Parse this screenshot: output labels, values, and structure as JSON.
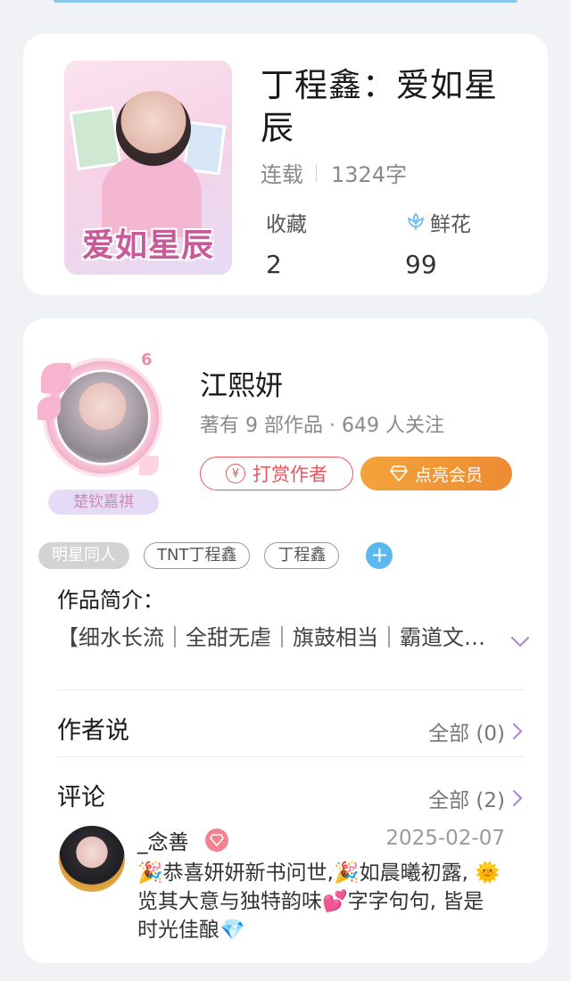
{
  "book": {
    "title": "丁程鑫：爱如星辰",
    "status": "连载",
    "word_count": "1324字",
    "cover_title": "爱如星辰",
    "favorites_label": "收藏",
    "favorites_value": "2",
    "flowers_label": "鲜花",
    "flowers_value": "99"
  },
  "author": {
    "name": "江熙妍",
    "info": "著有 9 部作品 · 649 人关注",
    "badge_number": "6",
    "avatar_tag": "楚钦嘉祺",
    "reward_label": "打赏作者",
    "reward_icon_glyph": "¥",
    "vip_label": "点亮会员"
  },
  "tags": [
    "明星同人",
    "TNT丁程鑫",
    "丁程鑫"
  ],
  "intro": {
    "label": "作品简介：",
    "text": "【细水长流｜全甜无虐｜旗鼓相当｜霸道文…"
  },
  "author_says": {
    "title": "作者说",
    "link": "全部 (0)"
  },
  "comments": {
    "title": "评论",
    "link": "全部 (2)",
    "items": [
      {
        "user": "_念善",
        "date": "2025-02-07",
        "text": "🎉恭喜妍妍新书问世,🎉如晨曦初露, 🌞 览其大意与独特韵味💕字字句句, 皆是时光佳酿💎"
      }
    ]
  },
  "colors": {
    "accent_red": "#e8575e",
    "vip_orange": "#f3a43b",
    "tag_add_blue": "#5db8ef",
    "chevron_purple": "#b08ad6"
  }
}
